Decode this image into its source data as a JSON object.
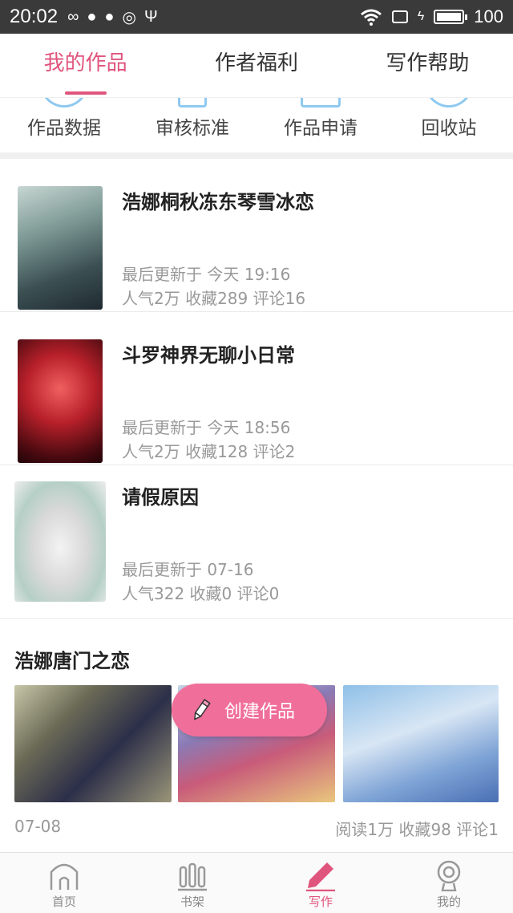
{
  "status_bar": {
    "time": "20:02",
    "battery_text": "100",
    "battery_level": 1.0
  },
  "tabs": [
    {
      "label": "我的作品",
      "active": true
    },
    {
      "label": "作者福利",
      "active": false
    },
    {
      "label": "写作帮助",
      "active": false
    }
  ],
  "quick_actions": [
    {
      "label": "作品数据",
      "icon": "data-icon"
    },
    {
      "label": "审核标准",
      "icon": "review-icon"
    },
    {
      "label": "作品申请",
      "icon": "apply-icon"
    },
    {
      "label": "回收站",
      "icon": "recycle-icon"
    }
  ],
  "works": [
    {
      "title": "浩娜桐秋冻东琴雪冰恋",
      "update": "最后更新于  今天  19:16",
      "stats": "人气2万 收藏289 评论16"
    },
    {
      "title": "斗罗神界无聊小日常",
      "update": "最后更新于  今天  18:56",
      "stats": "人气2万 收藏128 评论2"
    },
    {
      "title": "请假原因",
      "update": "最后更新于  07-16",
      "stats": "人气322 收藏0 评论0"
    }
  ],
  "series": {
    "title": "浩娜唐门之恋",
    "date": "07-08",
    "stats": "阅读1万 收藏98 评论1"
  },
  "fab": {
    "label": "创建作品"
  },
  "bottom_nav": [
    {
      "label": "首页",
      "icon": "home-icon",
      "active": false
    },
    {
      "label": "书架",
      "icon": "bookshelf-icon",
      "active": false
    },
    {
      "label": "写作",
      "icon": "pen-icon",
      "active": true
    },
    {
      "label": "我的",
      "icon": "profile-icon",
      "active": false
    }
  ],
  "colors": {
    "accent": "#e0557d",
    "fab": "#f06f9a",
    "statusbar": "#3a3a3a",
    "icon_blue": "#8fc9f0"
  }
}
